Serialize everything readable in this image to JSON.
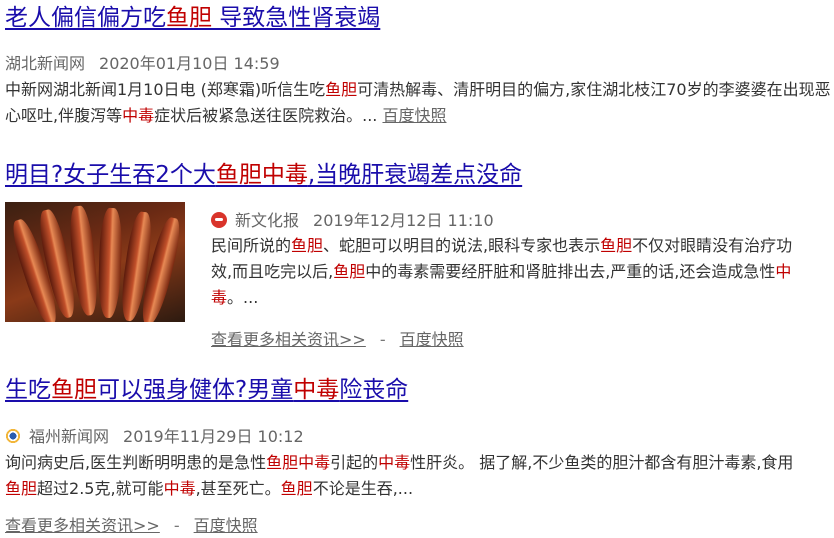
{
  "results": [
    {
      "title_parts": [
        "老人偏信偏方吃",
        "鱼胆",
        " 导致急性肾衰竭"
      ],
      "source": "湖北新闻网",
      "date": "2020年01月10日 14:59",
      "snippet_parts": [
        "中新网湖北新闻1月10日电 (郑寒霜)听信生吃",
        "鱼胆",
        "可清热解毒、清肝明目的偏方,家住湖北枝江70岁的李婆婆在出现恶心呕吐,伴腹泻等",
        "中毒",
        "症状后被紧急送往医院救治。..."
      ],
      "snapshot": "百度快照"
    },
    {
      "title_parts": [
        "明目?女子生吞2个大",
        "鱼胆中毒",
        ",当晚肝衰竭差点没命"
      ],
      "source": "新文化报",
      "date": "2019年12月12日 11:10",
      "snippet_parts": [
        "民间所说的",
        "鱼胆",
        "、蛇胆可以明目的说法,眼科专家也表示",
        "鱼胆",
        "不仅对眼睛没有治疗功效,而且吃完以后,",
        "鱼胆",
        "中的毒素需要经肝脏和肾脏排出去,严重的话,还会造成急性",
        "中毒",
        "。..."
      ],
      "more": "查看更多相关资讯>>",
      "separator": "-",
      "snapshot": "百度快照"
    },
    {
      "title_parts": [
        "生吃",
        "鱼胆",
        "可以强身健体?男童",
        "中毒",
        "险丧命"
      ],
      "source": "福州新闻网",
      "date": "2019年11月29日 10:12",
      "snippet_parts": [
        "询问病史后,医生判断明明患的是急性",
        "鱼胆中毒",
        "引起的",
        "中毒",
        "性肝炎。 据了解,不少鱼类的胆汁都含有胆汁毒素,食用",
        "鱼胆",
        "超过2.5克,就可能",
        "中毒",
        ",甚至死亡。",
        "鱼胆",
        "不论是生吞,..."
      ],
      "more": "查看更多相关资讯>>",
      "separator": "-",
      "snapshot": "百度快照"
    }
  ],
  "colors": {
    "title": "#1a0dab",
    "highlight": "#c00000",
    "meta": "#666666"
  }
}
